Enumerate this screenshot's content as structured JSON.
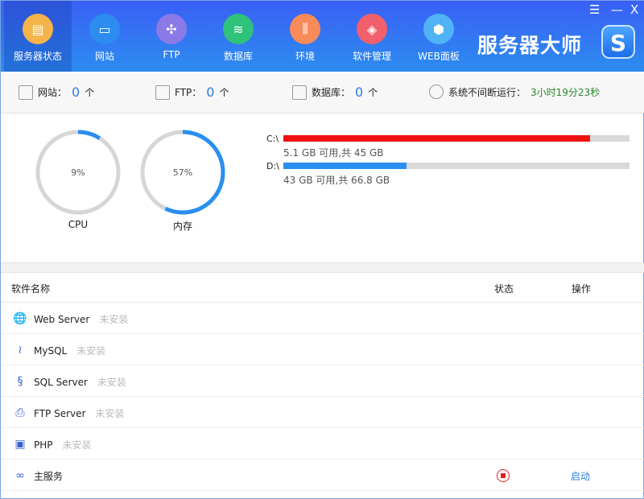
{
  "nav": {
    "tabs": [
      {
        "label": "服务器状态",
        "color": "#f5b44a",
        "glyph": "▤"
      },
      {
        "label": "网站",
        "color": "#2d8cf0",
        "glyph": "▭"
      },
      {
        "label": "FTP",
        "color": "#8b79e8",
        "glyph": "✣"
      },
      {
        "label": "数据库",
        "color": "#2fc27a",
        "glyph": "≋"
      },
      {
        "label": "环境",
        "color": "#f98a5a",
        "glyph": "⫼"
      },
      {
        "label": "软件管理",
        "color": "#f2606b",
        "glyph": "◈"
      },
      {
        "label": "WEB面板",
        "color": "#4fb3f5",
        "glyph": "⬢"
      }
    ],
    "brand": "服务器大师",
    "logo": "S"
  },
  "window": {
    "menu": "☰",
    "min": "—",
    "close": "X"
  },
  "stats": {
    "site_label": "网站：",
    "site_count": "0",
    "site_unit": "个",
    "ftp_label": "FTP：",
    "ftp_count": "0",
    "ftp_unit": "个",
    "db_label": "数据库：",
    "db_count": "0",
    "db_unit": "个",
    "uptime_label": "系统不间断运行：",
    "uptime": "3小时19分23秒"
  },
  "gauges": [
    {
      "label": "CPU",
      "value_text": "9%",
      "percent": 9
    },
    {
      "label": "内存",
      "value_text": "57%",
      "percent": 57
    }
  ],
  "disks": [
    {
      "name": "C:\\",
      "detail": "5.1 GB 可用,共 45 GB",
      "used_fraction": 0.887,
      "color": "#ee1111"
    },
    {
      "name": "D:\\",
      "detail": "43 GB 可用,共 66.8 GB",
      "used_fraction": 0.356,
      "color": "#2a8ef0"
    }
  ],
  "table": {
    "headers": {
      "name": "软件名称",
      "status": "状态",
      "action": "操作"
    },
    "rows": [
      {
        "name": "Web Server",
        "status": "未安装",
        "icon": "🌐"
      },
      {
        "name": "MySQL",
        "status": "未安装",
        "icon": "≀"
      },
      {
        "name": "SQL Server",
        "status": "未安装",
        "icon": "§"
      },
      {
        "name": "FTP Server",
        "status": "未安装",
        "icon": "⎙"
      },
      {
        "name": "PHP",
        "status": "未安装",
        "icon": "▣"
      },
      {
        "name": "主服务",
        "status": "",
        "icon": "∞",
        "action": "启动"
      }
    ]
  }
}
